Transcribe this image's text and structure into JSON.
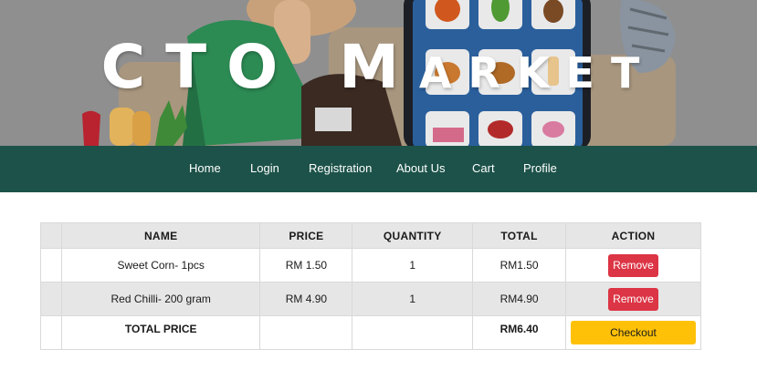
{
  "hero": {
    "title_first": "CTO",
    "title_second_initial": "M",
    "title_second_rest": "ARKET"
  },
  "nav": {
    "items": [
      {
        "label": "Home"
      },
      {
        "label": "Login"
      },
      {
        "label": "Registration"
      },
      {
        "label": "About Us"
      },
      {
        "label": "Cart"
      },
      {
        "label": "Profile"
      }
    ]
  },
  "cart": {
    "headers": [
      "",
      "NAME",
      "PRICE",
      "QUANTITY",
      "TOTAL",
      "ACTION"
    ],
    "rows": [
      {
        "name": "Sweet Corn- 1pcs",
        "price": "RM 1.50",
        "quantity": "1",
        "total": "RM1.50",
        "action": "Remove"
      },
      {
        "name": "Red Chilli- 200 gram",
        "price": "RM 4.90",
        "quantity": "1",
        "total": "RM4.90",
        "action": "Remove"
      }
    ],
    "total_label": "TOTAL PRICE",
    "total_value": "RM6.40",
    "checkout_label": "Checkout"
  },
  "colors": {
    "nav_bg": "#1c5249",
    "remove_button": "#dc3545",
    "checkout_button": "#ffc107"
  }
}
